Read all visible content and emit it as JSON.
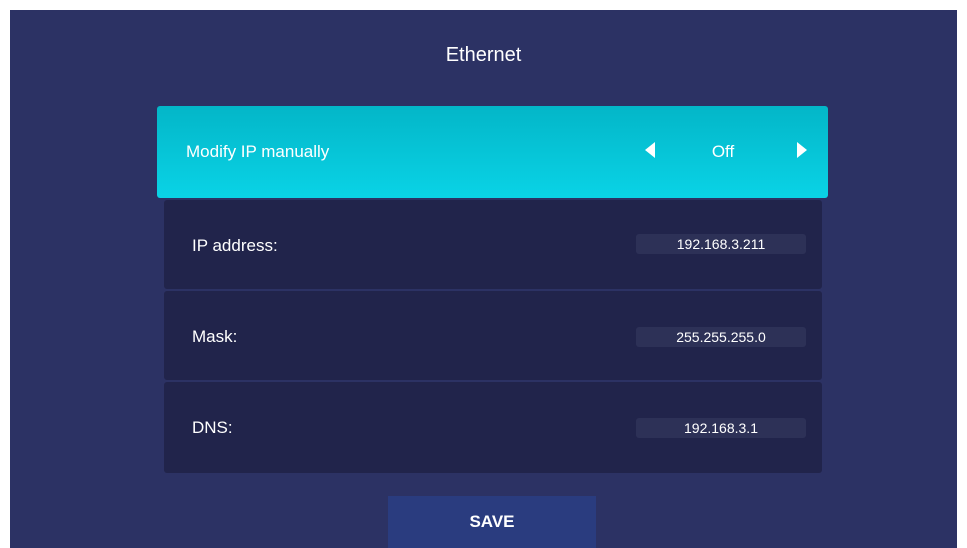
{
  "header": {
    "title": "Ethernet"
  },
  "manual_ip": {
    "label": "Modify IP manually",
    "value": "Off",
    "prev_icon": "caret-left-icon",
    "next_icon": "caret-right-icon"
  },
  "fields": {
    "ip_address": {
      "label": "IP address:",
      "value": "192.168.3.211"
    },
    "mask": {
      "label": "Mask:",
      "value": "255.255.255.0"
    },
    "dns": {
      "label": "DNS:",
      "value": "192.168.3.1"
    }
  },
  "actions": {
    "save_label": "SAVE"
  },
  "colors": {
    "background": "#2c3264",
    "row_background": "#21244b",
    "highlight": "#0ad3e6",
    "input_background": "#2d3157",
    "button_background": "#2a3c7f",
    "text": "#ffffff"
  }
}
